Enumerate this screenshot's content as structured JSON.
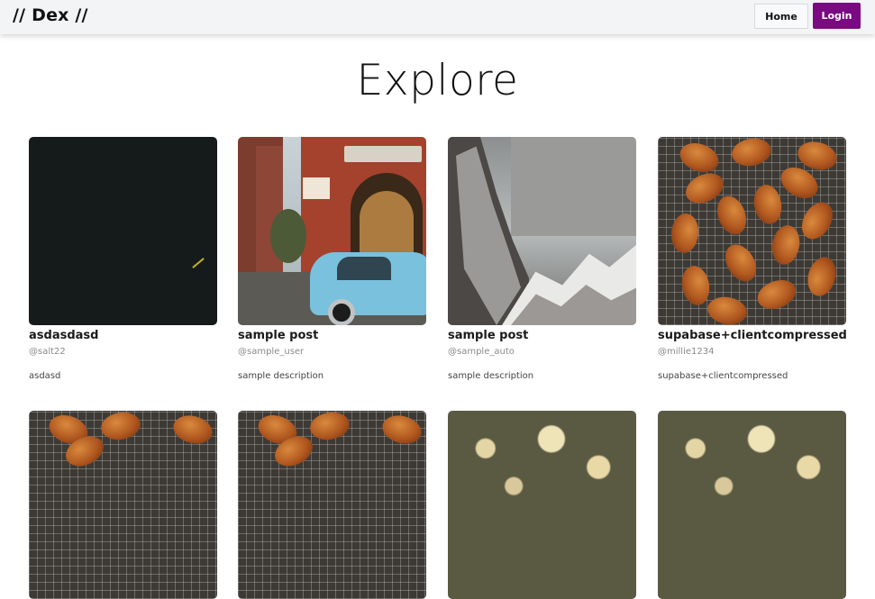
{
  "nav": {
    "brand": "// Dex //",
    "home_label": "Home",
    "login_label": "Login"
  },
  "page": {
    "title": "Explore"
  },
  "posts": [
    {
      "title": "asdasdasd",
      "user": "@salt22",
      "description": "asdasd",
      "image": "dark-abstract-image"
    },
    {
      "title": "sample post",
      "user": "@sample_user",
      "description": "sample description",
      "image": "street-shop-blue-car-image"
    },
    {
      "title": "sample post",
      "user": "@sample_auto",
      "description": "sample description",
      "image": "snowy-mountains-image"
    },
    {
      "title": "supabase+clientcompressed",
      "user": "@millie1234",
      "description": "supabase+clientcompressed",
      "image": "croissants-on-rack-image"
    }
  ],
  "second_row": [
    {
      "image": "croissants-on-rack-image"
    },
    {
      "image": "croissants-on-rack-image"
    },
    {
      "image": "forest-canopy-image"
    },
    {
      "image": "forest-canopy-image"
    }
  ],
  "colors": {
    "navbar_bg": "#f3f4f6",
    "login_bg": "#7a0a82",
    "text": "#111111",
    "muted": "#8a8a8a"
  }
}
